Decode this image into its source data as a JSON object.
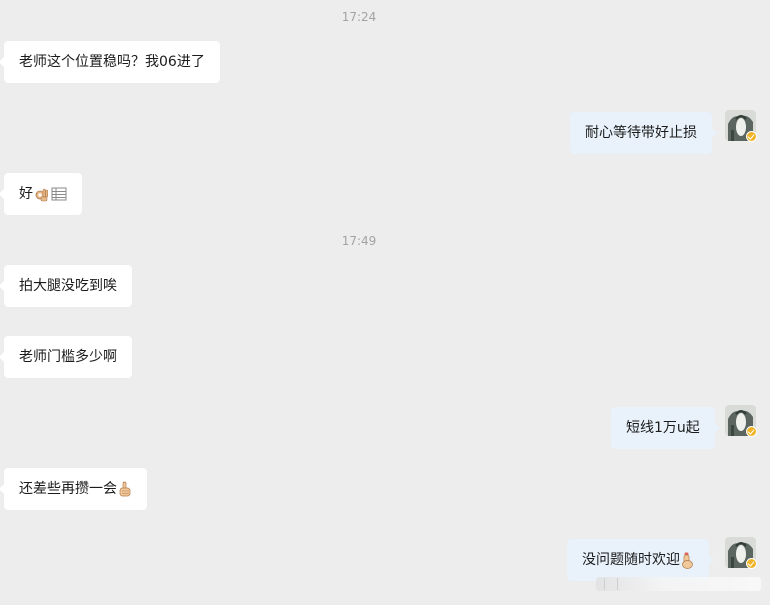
{
  "timestamps": [
    "17:24",
    "17:49"
  ],
  "messages": [
    {
      "side": "left",
      "text": "老师这个位置稳吗？我06进了"
    },
    {
      "side": "right",
      "text": "耐心等待带好止损"
    },
    {
      "side": "left",
      "text": "好"
    },
    {
      "side": "left",
      "text": "拍大腿没吃到唉"
    },
    {
      "side": "left",
      "text": "老师门槛多少啊"
    },
    {
      "side": "right",
      "text": "短线1万u起"
    },
    {
      "side": "left",
      "text": "还差些再攒一会"
    },
    {
      "side": "right",
      "text": "没问题随时欢迎"
    }
  ],
  "emoji": {
    "ok_hand": "ok-hand-emoji",
    "table": "table-grid-emoji",
    "thumbs_up": "thumbs-up-emoji",
    "wave_hand": "raised-hand-emoji"
  },
  "colors": {
    "background": "#ededed",
    "left_bubble": "#ffffff",
    "right_bubble": "#e9f2fb",
    "timestamp": "#a3a3a3",
    "verified_badge": "#f0b429"
  }
}
